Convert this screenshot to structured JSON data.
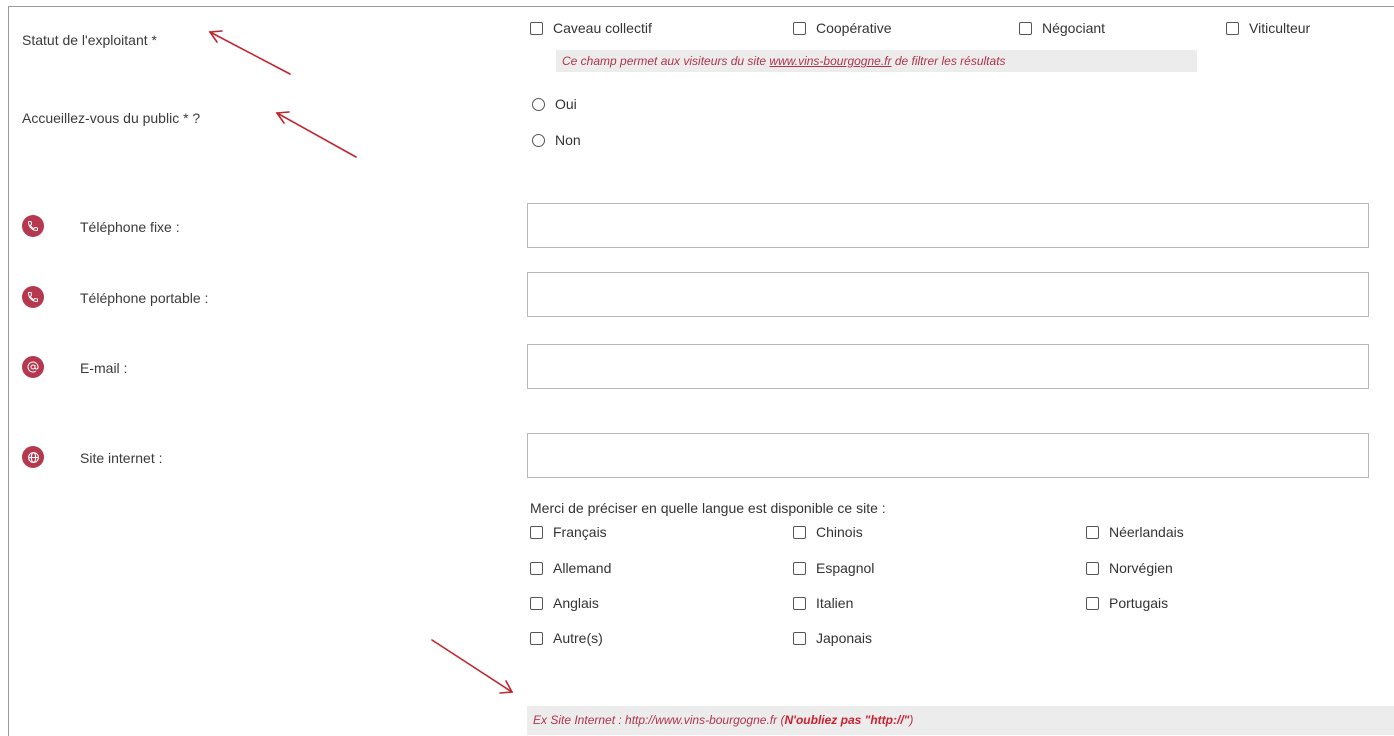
{
  "statut": {
    "label": "Statut de l'exploitant *",
    "options": [
      "Caveau collectif",
      "Coopérative",
      "Négociant",
      "Viticulteur"
    ],
    "note_prefix": "Ce champ permet aux visiteurs du site ",
    "note_link": "www.vins-bourgogne.fr",
    "note_suffix": " de filtrer les résultats"
  },
  "public": {
    "label": "Accueillez-vous du public * ?",
    "options": [
      "Oui",
      "Non"
    ]
  },
  "contact": {
    "phone_fixed_label": "Téléphone fixe :",
    "phone_mobile_label": "Téléphone portable :",
    "email_label": "E-mail :",
    "website_label": "Site internet :",
    "phone_icon_name": "phone-icon",
    "email_icon_name": "at-sign-icon",
    "globe_icon_name": "globe-icon",
    "icon_color": "#b6384e"
  },
  "languages": {
    "intro": "Merci de préciser en quelle langue est disponible ce site :",
    "col1": [
      "Français",
      "Allemand",
      "Anglais",
      "Autre(s)"
    ],
    "col2": [
      "Chinois",
      "Espagnol",
      "Italien",
      "Japonais"
    ],
    "col3": [
      "Néerlandais",
      "Norvégien",
      "Portugais"
    ]
  },
  "website_hint": {
    "prefix": "Ex Site Internet : http://www.vins-bourgogne.fr (",
    "emphasis": "N'oubliez pas \"http://\"",
    "suffix": ")"
  },
  "annotation_color": "#c0262d"
}
